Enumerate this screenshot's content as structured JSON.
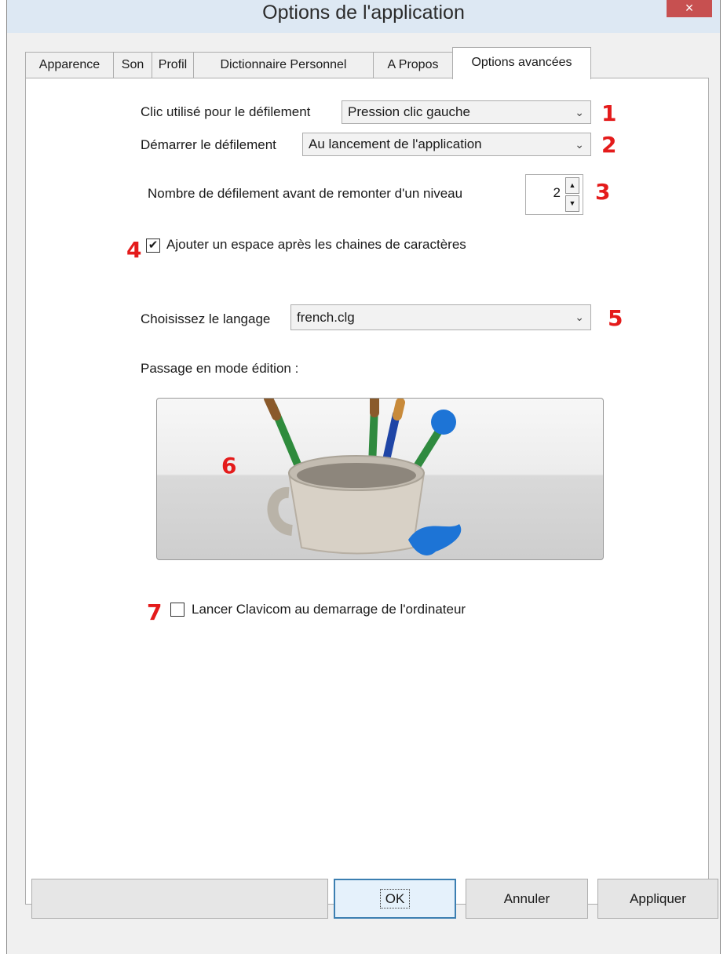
{
  "window": {
    "title": "Options de l'application",
    "close_label": "×"
  },
  "tabs": [
    {
      "label": "Apparence"
    },
    {
      "label": "Son"
    },
    {
      "label": "Profil"
    },
    {
      "label": "Dictionnaire Personnel"
    },
    {
      "label": "A Propos"
    },
    {
      "label": "Options avancées",
      "active": true
    }
  ],
  "scroll_click": {
    "label": "Clic utilisé pour le défilement",
    "value": "Pression clic gauche",
    "marker": "1"
  },
  "start_scroll": {
    "label": "Démarrer le défilement",
    "value": "Au lancement de l'application",
    "marker": "2"
  },
  "scroll_count": {
    "label": "Nombre de défilement avant de remonter d'un niveau",
    "value": "2",
    "marker": "3"
  },
  "add_space": {
    "label": "Ajouter un espace après les chaines de caractères",
    "checked": true,
    "marker": "4"
  },
  "language": {
    "label": "Choisissez le langage",
    "value": "french.clg",
    "marker": "5"
  },
  "edit_mode": {
    "label": "Passage en mode édition :",
    "marker": "6",
    "icon": "paintbrush-cup-icon"
  },
  "autostart": {
    "label": "Lancer Clavicom au demarrage de l'ordinateur",
    "checked": false,
    "marker": "7"
  },
  "buttons": {
    "ok": "OK",
    "cancel": "Annuler",
    "apply": "Appliquer"
  },
  "colors": {
    "marker": "#e41b1b",
    "title_bar": "#dde8f3",
    "close": "#c75050"
  },
  "icons": {
    "dropdown": "chevron-down-icon",
    "check": "checkmark-icon",
    "spin_up": "arrow-up-icon",
    "spin_down": "arrow-down-icon"
  }
}
